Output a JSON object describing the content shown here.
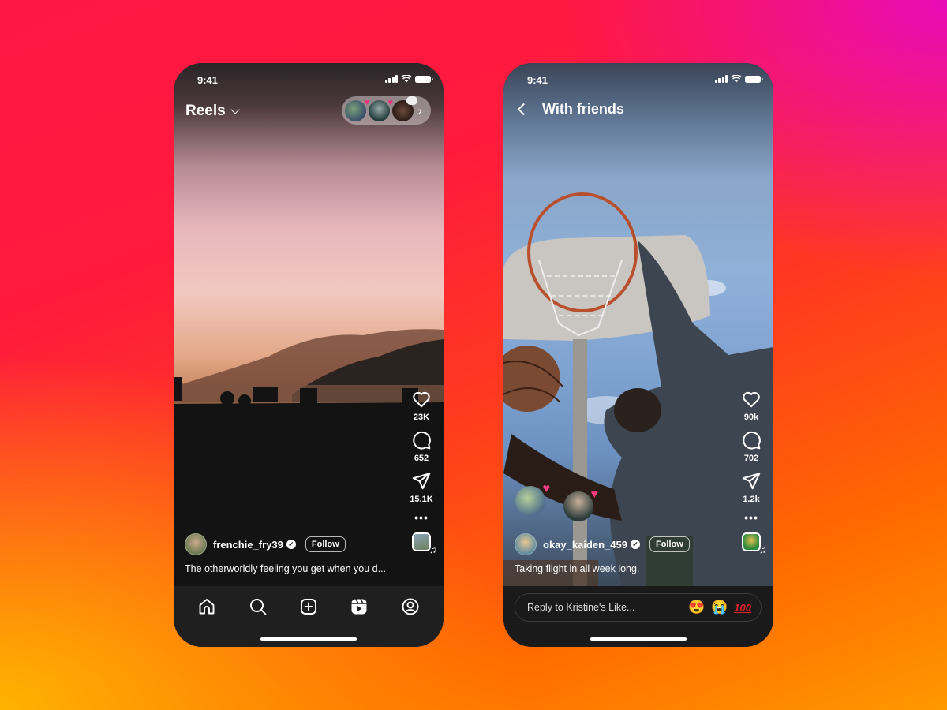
{
  "background": {
    "gradient_colors": [
      "#e80cb8",
      "#ff1744",
      "#ff6a00",
      "#ffb300"
    ]
  },
  "phones": {
    "left": {
      "status": {
        "time": "9:41"
      },
      "header": {
        "title": "Reels",
        "has_dropdown": true,
        "friends_pill": {
          "avatars": 3,
          "reaction_badges": [
            "heart",
            "heart",
            "message"
          ]
        }
      },
      "actions": {
        "like_count": "23K",
        "comment_count": "652",
        "share_count": "15.1K",
        "more_label": "•••"
      },
      "caption": {
        "username": "frenchie_fry39",
        "verified": true,
        "follow_label": "Follow",
        "text": "The otherworldly feeling you get when you d..."
      },
      "bottom_nav": [
        "home",
        "search",
        "create",
        "reels",
        "profile"
      ],
      "active_tab": "reels"
    },
    "right": {
      "status": {
        "time": "9:41"
      },
      "header": {
        "title": "With friends",
        "back": true
      },
      "actions": {
        "like_count": "90k",
        "comment_count": "702",
        "share_count": "1.2k",
        "more_label": "•••"
      },
      "friend_reactions": [
        "heart",
        "heart"
      ],
      "caption": {
        "username": "okay_kaiden_459",
        "verified": true,
        "follow_label": "Follow",
        "text": "Taking flight in all week long."
      },
      "reply": {
        "placeholder": "Reply to Kristine's Like...",
        "emojis": [
          "😍",
          "😭"
        ],
        "hundred": "100"
      }
    }
  },
  "icons": {
    "verified": "✓",
    "heart": "♥",
    "note": "♫",
    "chevron_right": "›"
  }
}
